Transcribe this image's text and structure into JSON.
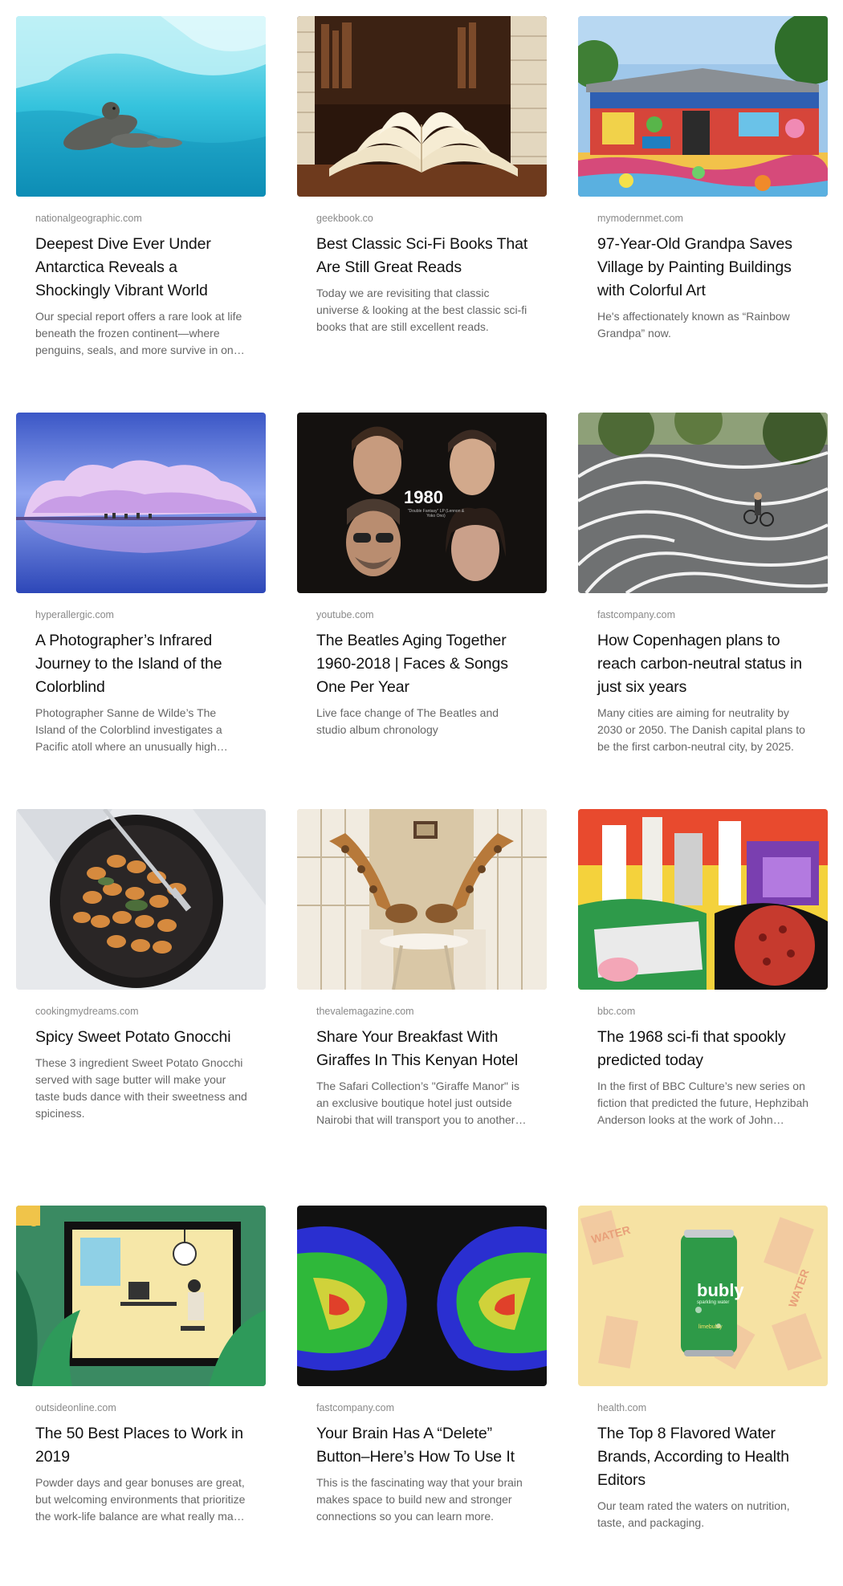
{
  "cards": [
    {
      "domain": "nationalgeographic.com",
      "title": "Deepest Dive Ever Under Antarctica Reveals a Shockingly Vibrant World",
      "excerpt": "Our special report offers a rare look at life beneath the frozen continent—where penguins, seals, and more survive in one of the planet's harshest environments."
    },
    {
      "domain": "geekbook.co",
      "title": "Best Classic Sci-Fi Books That Are Still Great Reads",
      "excerpt": "Today we are revisiting that classic universe & looking at the best classic sci-fi books that are still excellent reads."
    },
    {
      "domain": "mymodernmet.com",
      "title": "97-Year-Old Grandpa Saves Village by Painting Buildings with Colorful Art",
      "excerpt": "He's affectionately known as “Rainbow Grandpa” now."
    },
    {
      "domain": "hyperallergic.com",
      "title": "A Photographer’s Infrared Journey to the Island of the Colorblind",
      "excerpt": "Photographer Sanne de Wilde’s The Island of the Colorblind investigates a Pacific atoll where an unusually high percentage of the population is colorblind."
    },
    {
      "domain": "youtube.com",
      "title": "The Beatles Aging Together 1960-2018 | Faces & Songs One Per Year",
      "excerpt": "Live face change of The Beatles and studio album chronology",
      "image_caption": "1980",
      "image_subcaption": "\"Double Fantasy\" LP (Lennon & Yoko Ono)"
    },
    {
      "domain": "fastcompany.com",
      "title": "How Copenhagen plans to reach carbon-neutral status in just six years",
      "excerpt": "Many cities are aiming for neutrality by 2030 or 2050. The Danish capital plans to be the first carbon-neutral city, by 2025."
    },
    {
      "domain": "cookingmydreams.com",
      "title": "Spicy Sweet Potato Gnocchi",
      "excerpt": "These 3 ingredient Sweet Potato Gnocchi served with sage butter will make your taste buds dance with their sweetness and spiciness."
    },
    {
      "domain": "thevalemagazine.com",
      "title": "Share Your Breakfast With Giraffes In This Kenyan Hotel",
      "excerpt": "The Safari Collection’s \"Giraffe Manor\" is an exclusive boutique hotel just outside Nairobi that will transport you to another world."
    },
    {
      "domain": "bbc.com",
      "title": "The 1968 sci-fi that spookly predicted today",
      "excerpt": "In the first of BBC Culture’s new series on fiction that predicted the future, Hephzibah Anderson looks at the work of John Brunner, whose vision of overpopulation still resonates."
    },
    {
      "domain": "outsideonline.com",
      "title": "The 50 Best Places to Work in 2019",
      "excerpt": "Powder days and gear bonuses are great, but welcoming environments that prioritize the work-life balance are what really make these companies stand out."
    },
    {
      "domain": "fastcompany.com",
      "title": "Your Brain Has A “Delete” Button–Here’s How To Use It",
      "excerpt": "This is the fascinating way that your brain makes space to build new and stronger connections so you can learn more."
    },
    {
      "domain": "health.com",
      "title": "The Top 8 Flavored Water Brands, According to Health Editors",
      "excerpt": "Our team rated the waters on nutrition, taste, and packaging.",
      "image_brand": "bubly",
      "image_brand_sub": "sparkling water",
      "image_flavor": "limebubly",
      "image_bg_word": "WATER"
    }
  ],
  "colors": {
    "title": "#111111",
    "domain": "#8a8a8a",
    "excerpt": "#666666"
  }
}
